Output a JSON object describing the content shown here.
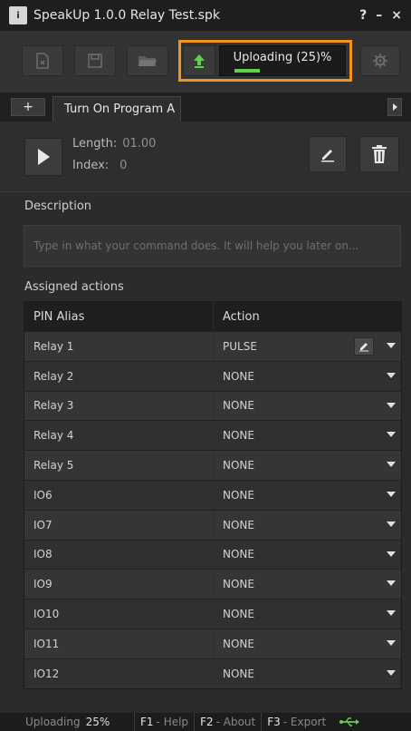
{
  "window": {
    "icon_text": "i",
    "title": "SpeakUp 1.0.0  Relay Test.spk",
    "help_label": "?",
    "minimize_label": "–",
    "close_label": "×"
  },
  "toolbar": {
    "upload_status": "Uploading (25)%",
    "upload_progress": 0.25,
    "highlight_color": "#f6931e",
    "progress_color": "#5fd24a"
  },
  "tabs": {
    "add_label": "+",
    "active_tab": "Turn On Program A"
  },
  "command": {
    "length_label": "Length:",
    "length_value": "01.00",
    "index_label": "Index:",
    "index_value": "0"
  },
  "description": {
    "label": "Description",
    "placeholder": "Type in what your command does. It will help you later on..."
  },
  "actions": {
    "label": "Assigned actions",
    "columns": [
      "PIN Alias",
      "Action"
    ],
    "rows": [
      {
        "alias": "Relay 1",
        "action": "PULSE"
      },
      {
        "alias": "Relay 2",
        "action": "NONE"
      },
      {
        "alias": "Relay 3",
        "action": "NONE"
      },
      {
        "alias": "Relay 4",
        "action": "NONE"
      },
      {
        "alias": "Relay 5",
        "action": "NONE"
      },
      {
        "alias": "IO6",
        "action": "NONE"
      },
      {
        "alias": "IO7",
        "action": "NONE"
      },
      {
        "alias": "IO8",
        "action": "NONE"
      },
      {
        "alias": "IO9",
        "action": "NONE"
      },
      {
        "alias": "IO10",
        "action": "NONE"
      },
      {
        "alias": "IO11",
        "action": "NONE"
      },
      {
        "alias": "IO12",
        "action": "NONE"
      }
    ]
  },
  "statusbar": {
    "uploading_label": "Uploading",
    "uploading_value": "25%",
    "keys": [
      {
        "key": "F1",
        "label": "- Help"
      },
      {
        "key": "F2",
        "label": "- About"
      },
      {
        "key": "F3",
        "label": "- Export"
      }
    ]
  }
}
